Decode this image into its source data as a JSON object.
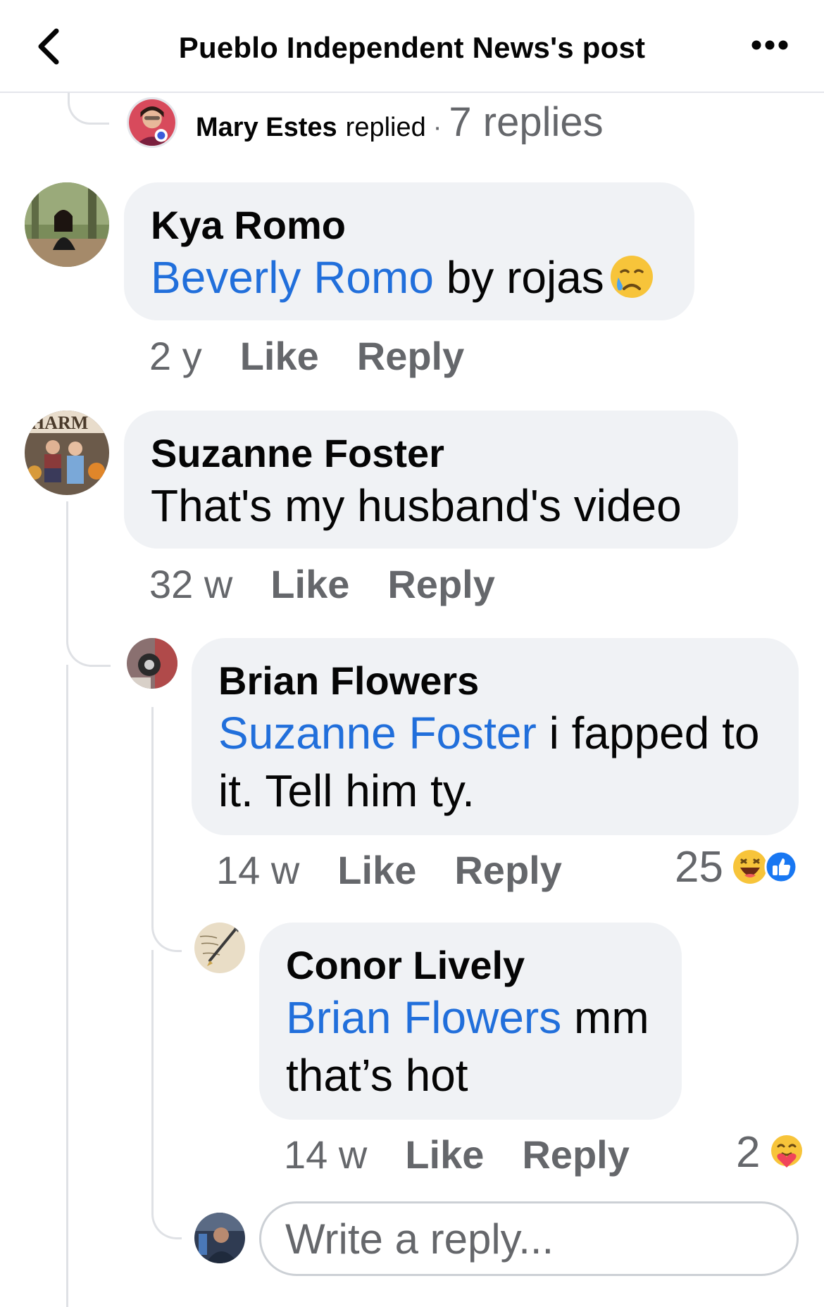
{
  "header": {
    "title": "Pueblo Independent News's post"
  },
  "replied_row": {
    "name": "Mary Estes",
    "verb": "replied",
    "separator": "·",
    "count": "7 replies"
  },
  "comments": [
    {
      "author": "Kya Romo",
      "mention": "Beverly Romo",
      "text": " by rojas",
      "emoji": "crying-face",
      "time": "2 y",
      "like": "Like",
      "reply": "Reply"
    },
    {
      "author": "Suzanne Foster",
      "text": "That's my husband's video",
      "time": "32 w",
      "like": "Like",
      "reply": "Reply"
    },
    {
      "author": "Brian Flowers",
      "mention": "Suzanne Foster",
      "text": " i fapped to it. Tell him ty.",
      "time": "14 w",
      "like": "Like",
      "reply": "Reply",
      "reaction_count": "25",
      "reactions": [
        "haha",
        "like"
      ]
    },
    {
      "author": "Conor Lively",
      "mention": "Brian Flowers",
      "text": " mm that’s hot",
      "time": "14 w",
      "like": "Like",
      "reply": "Reply",
      "reaction_count": "2",
      "reactions": [
        "care"
      ]
    }
  ],
  "reply_box": {
    "placeholder": "Write a reply..."
  },
  "colors": {
    "link": "#216fdb",
    "bubble": "#f0f2f5",
    "secondary_text": "#65676b",
    "like_blue": "#1877f2"
  }
}
